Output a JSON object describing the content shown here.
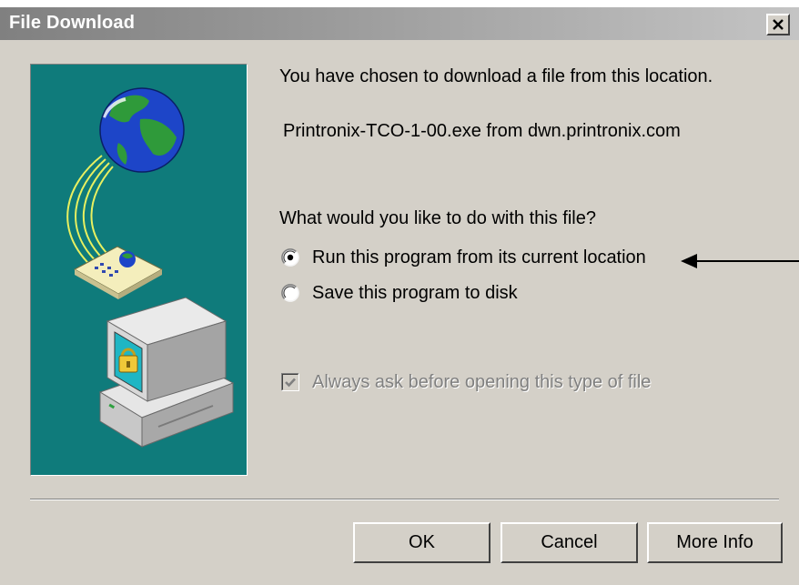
{
  "window": {
    "title": "File Download",
    "close_icon": "close-icon"
  },
  "content": {
    "intro": "You have chosen to download a file from this location.",
    "file_info": "Printronix-TCO-1-00.exe from dwn.printronix.com",
    "question": "What would you like to do with this file?",
    "options": [
      {
        "label": "Run this program from its current location",
        "selected": true
      },
      {
        "label": "Save this program to disk",
        "selected": false
      }
    ],
    "always_ask": {
      "label": "Always ask before opening this type of file",
      "checked": true,
      "enabled": false
    }
  },
  "buttons": {
    "ok": "OK",
    "cancel": "Cancel",
    "more_info": "More Info"
  },
  "illustration": {
    "icons": [
      "globe-icon",
      "document-icon",
      "computer-icon",
      "padlock-icon"
    ],
    "background_color": "#0f7b7b"
  },
  "annotation": {
    "arrow_icon": "left-arrow-icon"
  },
  "colors": {
    "dialog_face": "#d4d0c8",
    "title_bar": "#808080",
    "disabled_text": "#808080"
  }
}
